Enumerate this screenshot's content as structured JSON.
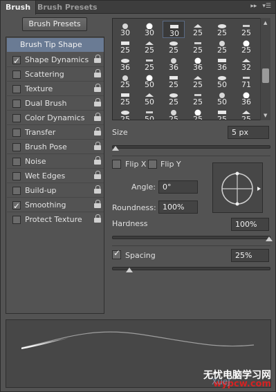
{
  "tabs": {
    "active": "Brush",
    "inactive": "Brush Presets"
  },
  "left": {
    "presets_button": "Brush Presets",
    "tip_shape": "Brush Tip Shape",
    "options": [
      {
        "label": "Shape Dynamics",
        "checked": true
      },
      {
        "label": "Scattering",
        "checked": false
      },
      {
        "label": "Texture",
        "checked": false
      },
      {
        "label": "Dual Brush",
        "checked": false
      },
      {
        "label": "Color Dynamics",
        "checked": false
      },
      {
        "label": "Transfer",
        "checked": false
      },
      {
        "label": "Brush Pose",
        "checked": false
      },
      {
        "label": "Noise",
        "checked": false
      },
      {
        "label": "Wet Edges",
        "checked": false
      },
      {
        "label": "Build-up",
        "checked": false
      },
      {
        "label": "Smoothing",
        "checked": true
      },
      {
        "label": "Protect Texture",
        "checked": false
      }
    ]
  },
  "brush_grid": {
    "rows": [
      [
        "30",
        "30",
        "30",
        "25",
        "25",
        "25"
      ],
      [
        "25",
        "25",
        "25",
        "25",
        "25",
        "25"
      ],
      [
        "36",
        "25",
        "36",
        "36",
        "36",
        "32"
      ],
      [
        "25",
        "50",
        "25",
        "25",
        "50",
        "71"
      ],
      [
        "25",
        "50",
        "25",
        "25",
        "50",
        "36"
      ],
      [
        "25",
        "50",
        "25",
        "25",
        "25",
        "25"
      ]
    ],
    "selected": "30"
  },
  "controls": {
    "size_label": "Size",
    "size_value": "5 px",
    "size_level": 0.02,
    "flip_x": "Flip X",
    "flip_y": "Flip Y",
    "angle_label": "Angle:",
    "angle_value": "0°",
    "roundness_label": "Roundness:",
    "roundness_value": "100%",
    "hardness_label": "Hardness",
    "hardness_value": "100%",
    "hardness_level": 1.0,
    "spacing_label": "Spacing",
    "spacing_value": "25%",
    "spacing_level": 0.11,
    "spacing_checked": true
  },
  "watermark": {
    "line1": "无忧电脑学习网",
    "line2": "wypcw.com",
    "faint": "XueJ"
  },
  "colors": {
    "panel": "#535353",
    "selection": "#6a7b94",
    "dark": "#3d3d3d"
  }
}
